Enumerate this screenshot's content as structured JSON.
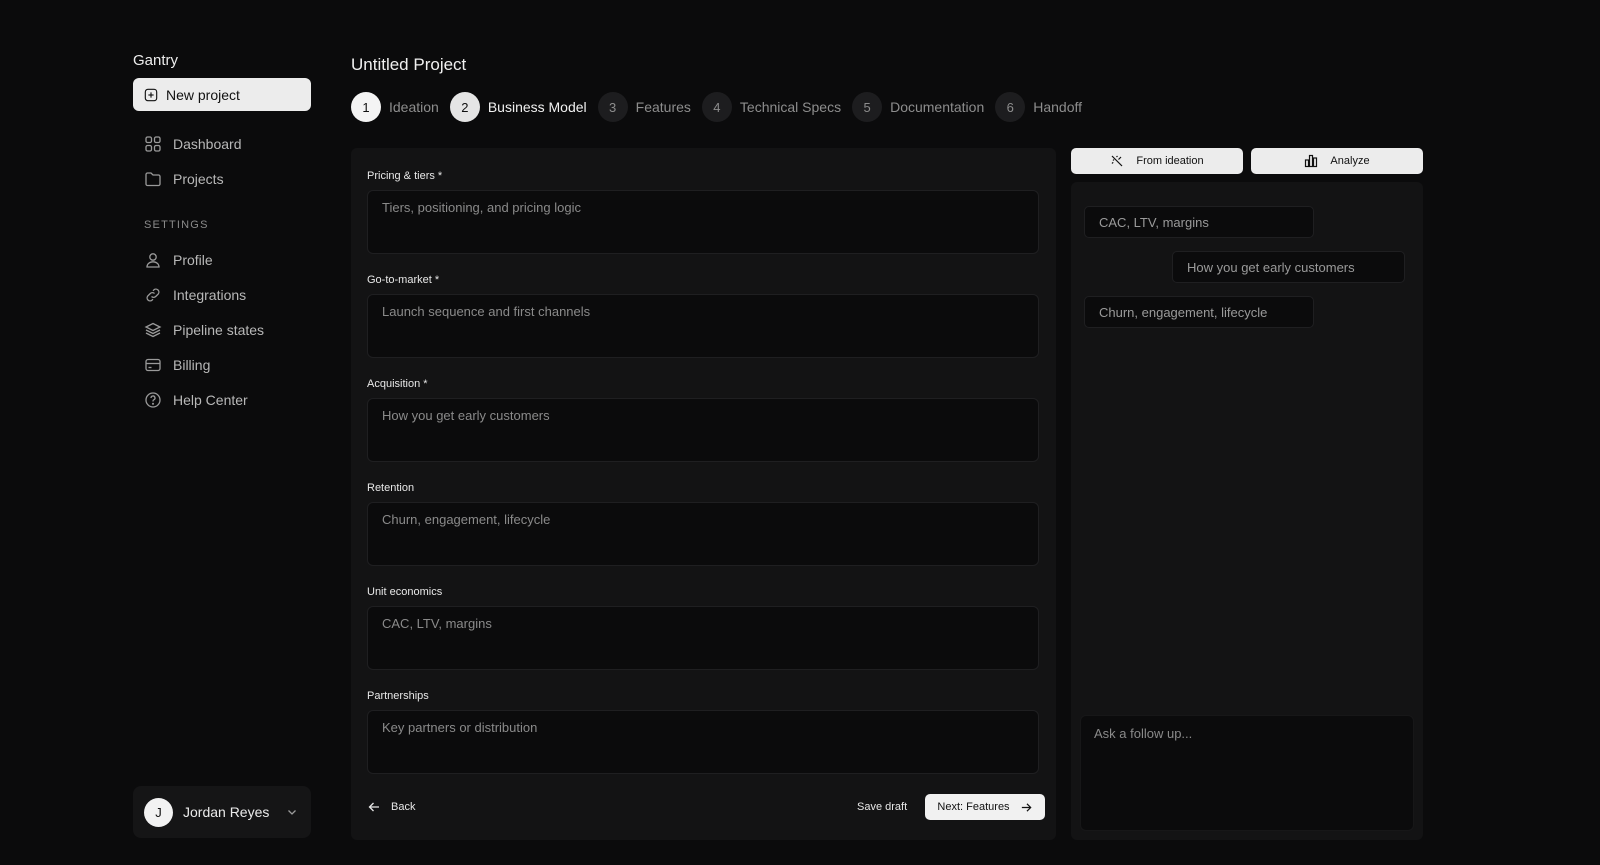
{
  "sidebar": {
    "brand": "Gantry",
    "new_project_label": "New project",
    "nav_items": [
      {
        "label": "Dashboard",
        "icon": "dashboard-icon"
      },
      {
        "label": "Projects",
        "icon": "folder-icon"
      }
    ],
    "settings_label": "SETTINGS",
    "settings_items": [
      {
        "label": "Profile",
        "icon": "user-icon"
      },
      {
        "label": "Integrations",
        "icon": "link-icon"
      },
      {
        "label": "Pipeline states",
        "icon": "layers-icon"
      },
      {
        "label": "Billing",
        "icon": "card-icon"
      },
      {
        "label": "Help Center",
        "icon": "help-icon"
      }
    ],
    "user": {
      "initial": "J",
      "name": "Jordan Reyes"
    }
  },
  "header": {
    "project_title": "Untitled Project",
    "steps": [
      {
        "num": "1",
        "label": "Ideation",
        "state": "done"
      },
      {
        "num": "2",
        "label": "Business Model",
        "state": "current"
      },
      {
        "num": "3",
        "label": "Features",
        "state": "upcoming"
      },
      {
        "num": "4",
        "label": "Technical Specs",
        "state": "upcoming"
      },
      {
        "num": "5",
        "label": "Documentation",
        "state": "upcoming"
      },
      {
        "num": "6",
        "label": "Handoff",
        "state": "upcoming"
      }
    ]
  },
  "form": {
    "fields": [
      {
        "label": "Pricing & tiers *",
        "placeholder": "Tiers, positioning, and pricing logic"
      },
      {
        "label": "Go-to-market *",
        "placeholder": "Launch sequence and first channels"
      },
      {
        "label": "Acquisition *",
        "placeholder": "How you get early customers"
      },
      {
        "label": "Retention",
        "placeholder": "Churn, engagement, lifecycle"
      },
      {
        "label": "Unit economics",
        "placeholder": "CAC, LTV, margins"
      },
      {
        "label": "Partnerships",
        "placeholder": "Key partners or distribution"
      }
    ],
    "back_label": "Back",
    "save_draft_label": "Save draft",
    "next_label": "Next: Features"
  },
  "assistant": {
    "from_ideation_label": "From ideation",
    "analyze_label": "Analyze",
    "suggestions": [
      "CAC, LTV, margins",
      "How you get early customers",
      "Churn, engagement, lifecycle"
    ],
    "followup_placeholder": "Ask a follow up..."
  },
  "colors": {
    "background": "#0b0b0c",
    "panel": "#131314",
    "accent_light": "#ececec"
  }
}
